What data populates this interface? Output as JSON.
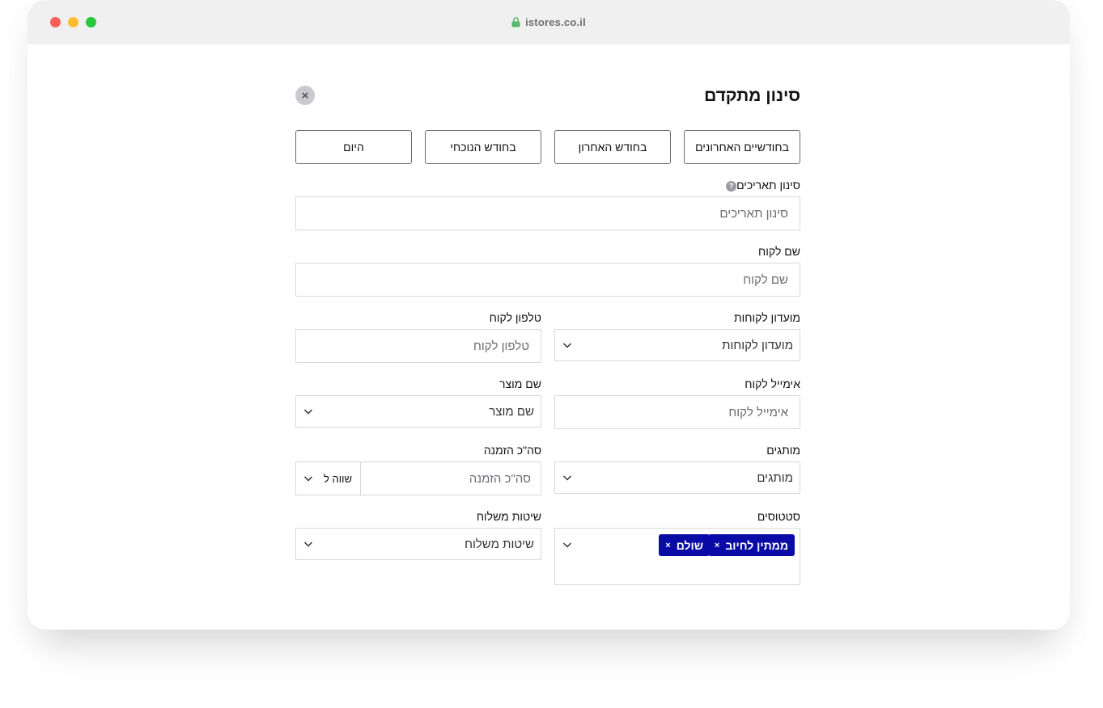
{
  "browser": {
    "url": "istores.co.il"
  },
  "panel": {
    "title": "סינון מתקדם",
    "close_icon": "×"
  },
  "quick_filters": [
    "בחודשיים האחרונים",
    "בחודש האחרון",
    "בחודש הנוכחי",
    "היום"
  ],
  "fields": {
    "dates": {
      "label": "סינון תאריכים",
      "placeholder": "סינון תאריכים",
      "help_icon": "?"
    },
    "customer_name": {
      "label": "שם לקוח",
      "placeholder": "שם לקוח"
    },
    "customer_club": {
      "label": "מועדון לקוחות",
      "value": "מועדון לקוחות"
    },
    "customer_phone": {
      "label": "טלפון לקוח",
      "placeholder": "טלפון לקוח"
    },
    "customer_email": {
      "label": "אימייל לקוח",
      "placeholder": "אימייל לקוח"
    },
    "product_name": {
      "label": "שם מוצר",
      "value": "שם מוצר"
    },
    "brands": {
      "label": "מותגים",
      "value": "מותגים"
    },
    "order_total": {
      "label": "סה\"כ הזמנה",
      "placeholder": "סה\"כ הזמנה",
      "operator": "שווה ל"
    },
    "statuses": {
      "label": "סטטוסים",
      "tags": [
        "ממתין לחיוב",
        "שולם"
      ],
      "tag_remove_icon": "×"
    },
    "shipping": {
      "label": "שיטות משלוח",
      "value": "שיטות משלוח"
    }
  }
}
